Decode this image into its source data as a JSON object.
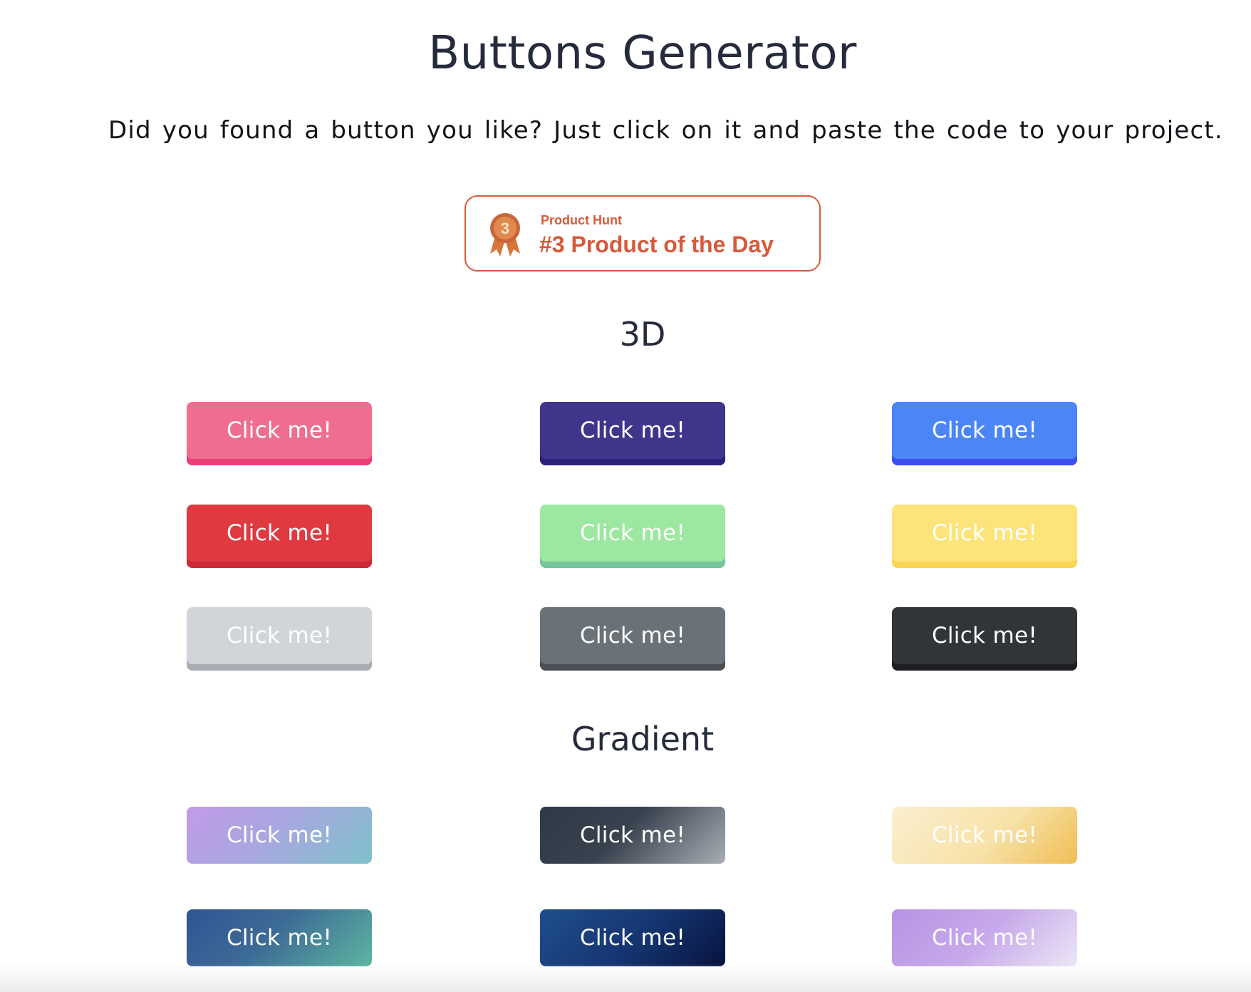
{
  "header": {
    "title": "Buttons Generator",
    "intro": "Did you found a button you like? Just click on it and paste the code to your project."
  },
  "badge": {
    "kicker": "Product Hunt",
    "headline": "#3 Product of the Day",
    "medal_number": "3",
    "color": "#d65a3a",
    "icon": "medal-icon"
  },
  "sections": {
    "three_d": {
      "title": "3D",
      "buttons": [
        {
          "label": "Click me!",
          "color": "#ef6d8e",
          "shade": "#ea3e78"
        },
        {
          "label": "Click me!",
          "color": "#3d368a",
          "shade": "#2a2278"
        },
        {
          "label": "Click me!",
          "color": "#4b85f6",
          "shade": "#3b4ef0"
        },
        {
          "label": "Click me!",
          "color": "#e0393f",
          "shade": "#c92a35"
        },
        {
          "label": "Click me!",
          "color": "#9ce8a0",
          "shade": "#74c79a"
        },
        {
          "label": "Click me!",
          "color": "#fde47a",
          "shade": "#f8d653"
        },
        {
          "label": "Click me!",
          "color": "#d1d5da",
          "shade": "#a8acb2"
        },
        {
          "label": "Click me!",
          "color": "#6b7277",
          "shade": "#494f54"
        },
        {
          "label": "Click me!",
          "color": "#323538",
          "shade": "#1d1f22"
        }
      ]
    },
    "gradient": {
      "title": "Gradient",
      "buttons": [
        {
          "label": "Click me!",
          "colors": [
            "#c29be8",
            "#7fc1cb"
          ]
        },
        {
          "label": "Click me!",
          "colors": [
            "#2e3947",
            "#a9aeb5"
          ]
        },
        {
          "label": "Click me!",
          "colors": [
            "#fbefd0",
            "#f0bd55"
          ]
        },
        {
          "label": "Click me!",
          "colors": [
            "#2f5595",
            "#5db5a0"
          ]
        },
        {
          "label": "Click me!",
          "colors": [
            "#1f4e8e",
            "#07123d"
          ]
        },
        {
          "label": "Click me!",
          "colors": [
            "#b894e4",
            "#ece6f6"
          ]
        }
      ]
    }
  }
}
